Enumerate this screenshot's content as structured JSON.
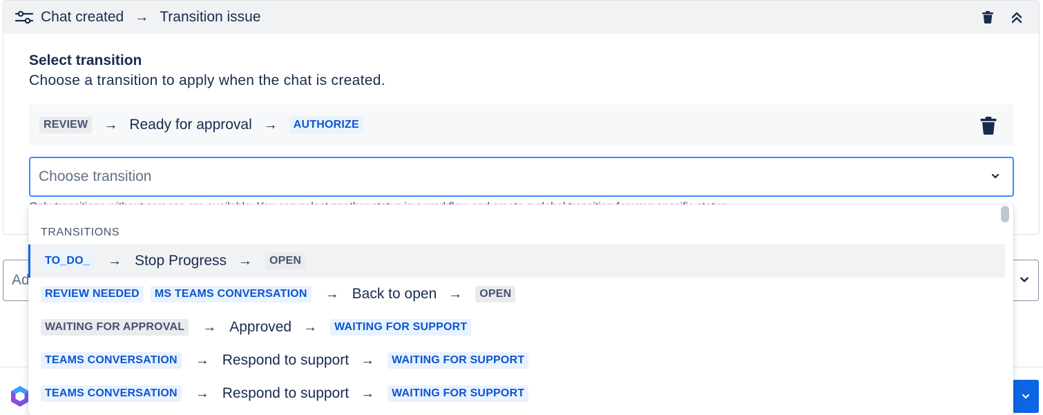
{
  "header": {
    "trigger": "Chat created",
    "action": "Transition issue"
  },
  "section": {
    "title": "Select transition",
    "description": "Choose a transition to apply when the chat is created."
  },
  "selected_transition": {
    "from": "REVIEW",
    "name": "Ready for approval",
    "to": "AUTHORIZE"
  },
  "transition_select": {
    "placeholder": "Choose transition"
  },
  "helper_text": "Only transitions without screens are available. You can select another status in a workflow and create a global transition for your specific status.",
  "second_select": {
    "placeholder": "Ad"
  },
  "menu": {
    "group_label": "TRANSITIONS",
    "items": [
      {
        "from": [
          "TO_DO_"
        ],
        "name": "Stop Progress",
        "to": "OPEN"
      },
      {
        "from": [
          "REVIEW NEEDED",
          "MS TEAMS CONVERSATION"
        ],
        "name": "Back to open",
        "to": "OPEN"
      },
      {
        "from": [
          "WAITING FOR APPROVAL"
        ],
        "name": "Approved",
        "to": "WAITING FOR SUPPORT"
      },
      {
        "from": [
          "TEAMS CONVERSATION"
        ],
        "name": "Respond to support",
        "to": "WAITING FOR SUPPORT"
      },
      {
        "from": [
          "TEAMS CONVERSATION"
        ],
        "name": "Respond to support",
        "to": "WAITING FOR SUPPORT"
      }
    ]
  },
  "colors": {
    "accent": "#0c66e4",
    "focus_border": "#388bff",
    "lozenge_blue_text": "#0c55cf",
    "lozenge_blue_bg": "#e9f2ff",
    "lozenge_grey_text": "#44546f",
    "lozenge_grey_bg": "#e9ebee"
  },
  "icons": {
    "header_icon": "sliders-icon",
    "delete": "trash-icon",
    "collapse": "chevron-double-up-icon",
    "dropdown": "chevron-down-icon",
    "arrow": "arrow-right-icon",
    "footer_logo": "copilot-logo"
  }
}
